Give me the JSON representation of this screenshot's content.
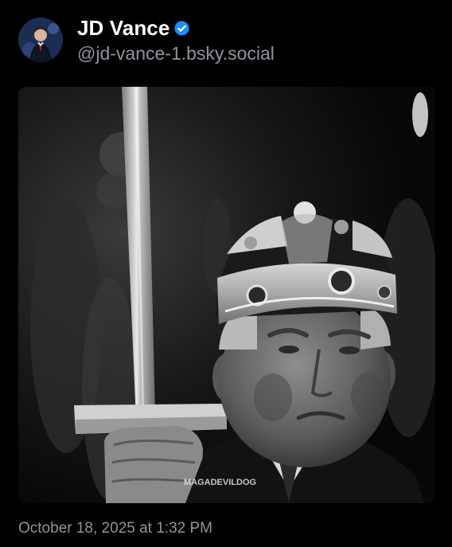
{
  "post": {
    "author": {
      "display_name": "JD Vance",
      "handle": "@jd-vance-1.bsky.social",
      "verified": true,
      "verified_icon": "verified-check-icon",
      "verified_color": "#1d8cff"
    },
    "image": {
      "watermark": "MAGADEVILDOG",
      "style": "black-and-white"
    },
    "timestamp": "October 18, 2025 at 1:32 PM"
  },
  "colors": {
    "background": "#000000",
    "text_primary": "#ffffff",
    "text_secondary": "#8e949c"
  }
}
